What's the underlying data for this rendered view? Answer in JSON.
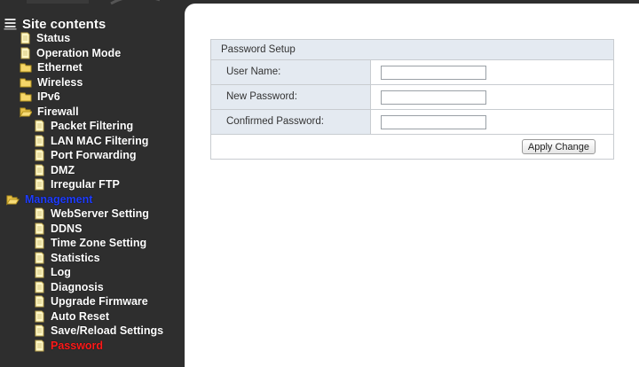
{
  "sidebar": {
    "root": "Site contents",
    "items": [
      {
        "label": "Status",
        "icon": "document-icon"
      },
      {
        "label": "Operation Mode",
        "icon": "document-icon"
      },
      {
        "label": "Ethernet",
        "icon": "folder-icon"
      },
      {
        "label": "Wireless",
        "icon": "folder-icon"
      },
      {
        "label": "IPv6",
        "icon": "folder-icon"
      },
      {
        "label": "Firewall",
        "icon": "folder-open-icon"
      },
      {
        "label": "Packet Filtering",
        "icon": "document-icon"
      },
      {
        "label": "LAN MAC Filtering",
        "icon": "document-icon"
      },
      {
        "label": "Port Forwarding",
        "icon": "document-icon"
      },
      {
        "label": "DMZ",
        "icon": "document-icon"
      },
      {
        "label": "Irregular FTP",
        "icon": "document-icon"
      },
      {
        "label": "Management",
        "icon": "folder-open-icon"
      },
      {
        "label": "WebServer Setting",
        "icon": "document-icon"
      },
      {
        "label": "DDNS",
        "icon": "document-icon"
      },
      {
        "label": "Time Zone Setting",
        "icon": "document-icon"
      },
      {
        "label": "Statistics",
        "icon": "document-icon"
      },
      {
        "label": "Log",
        "icon": "document-icon"
      },
      {
        "label": "Diagnosis",
        "icon": "document-icon"
      },
      {
        "label": "Upgrade Firmware",
        "icon": "document-icon"
      },
      {
        "label": "Auto Reset",
        "icon": "document-icon"
      },
      {
        "label": "Save/Reload Settings",
        "icon": "document-icon"
      },
      {
        "label": "Password",
        "icon": "document-icon"
      }
    ]
  },
  "form": {
    "title": "Password Setup",
    "user_name_label": "User Name:",
    "user_name_value": "",
    "new_password_label": "New Password:",
    "new_password_value": "",
    "confirmed_password_label": "Confirmed Password:",
    "confirmed_password_value": "",
    "apply_label": "Apply Change"
  },
  "colors": {
    "sidebar_bg": "#2e2e2e",
    "open_section": "#1f3dff",
    "active_item": "#ff1a1a",
    "panel_header": "#e4eaf1"
  }
}
